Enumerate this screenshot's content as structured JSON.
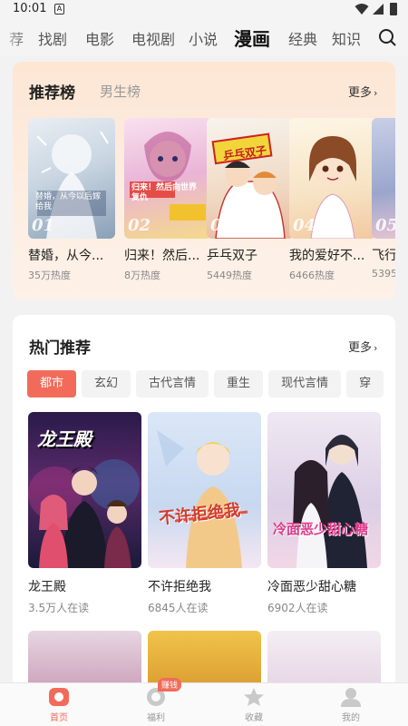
{
  "status_bar": {
    "time": "10:01",
    "sim_label": "A"
  },
  "top_nav": {
    "tabs": [
      "荐",
      "找剧",
      "电影",
      "电视剧",
      "小说",
      "漫画",
      "经典",
      "知识"
    ],
    "active_tab": "漫画"
  },
  "ranking": {
    "tab_recommend": "推荐榜",
    "tab_male": "男生榜",
    "more_label": "更多",
    "items": [
      {
        "rank": "01",
        "title": "替婚，从今...",
        "heat": "35万热度",
        "cover_text": "替婚，从今以后嫁给我"
      },
      {
        "rank": "02",
        "title": "归来！然后...",
        "heat": "8万热度",
        "cover_text": "归来！然后向世界复仇"
      },
      {
        "rank": "03",
        "title": "乒乓双子",
        "heat": "5449热度",
        "cover_text": "乒乓双子"
      },
      {
        "rank": "04",
        "title": "我的爱好不...",
        "heat": "6466热度",
        "cover_text": ""
      },
      {
        "rank": "05",
        "title": "飞行",
        "heat": "5395",
        "cover_text": ""
      }
    ]
  },
  "hot": {
    "title": "热门推荐",
    "more_label": "更多",
    "chips": [
      "都市",
      "玄幻",
      "古代言情",
      "重生",
      "现代言情",
      "穿"
    ],
    "active_chip": "都市",
    "items": [
      {
        "title": "龙王殿",
        "reads": "3.5万人在读",
        "cover_text": "龙王殿"
      },
      {
        "title": "不许拒绝我",
        "reads": "6845人在读",
        "cover_text": "不许拒绝我"
      },
      {
        "title": "冷面恶少甜心糖",
        "reads": "6902人在读",
        "cover_text": "冷面恶少甜心糖"
      }
    ]
  },
  "bottom_nav": {
    "items": [
      {
        "label": "首页",
        "icon": "home-icon",
        "active": true
      },
      {
        "label": "福利",
        "icon": "welfare-icon",
        "active": false
      },
      {
        "label": "收藏",
        "icon": "star-icon",
        "active": false
      },
      {
        "label": "我的",
        "icon": "user-icon",
        "active": false
      }
    ],
    "badge": "赚钱"
  },
  "colors": {
    "accent": "#f26b5a",
    "rank_bg": "#fde6d4"
  }
}
